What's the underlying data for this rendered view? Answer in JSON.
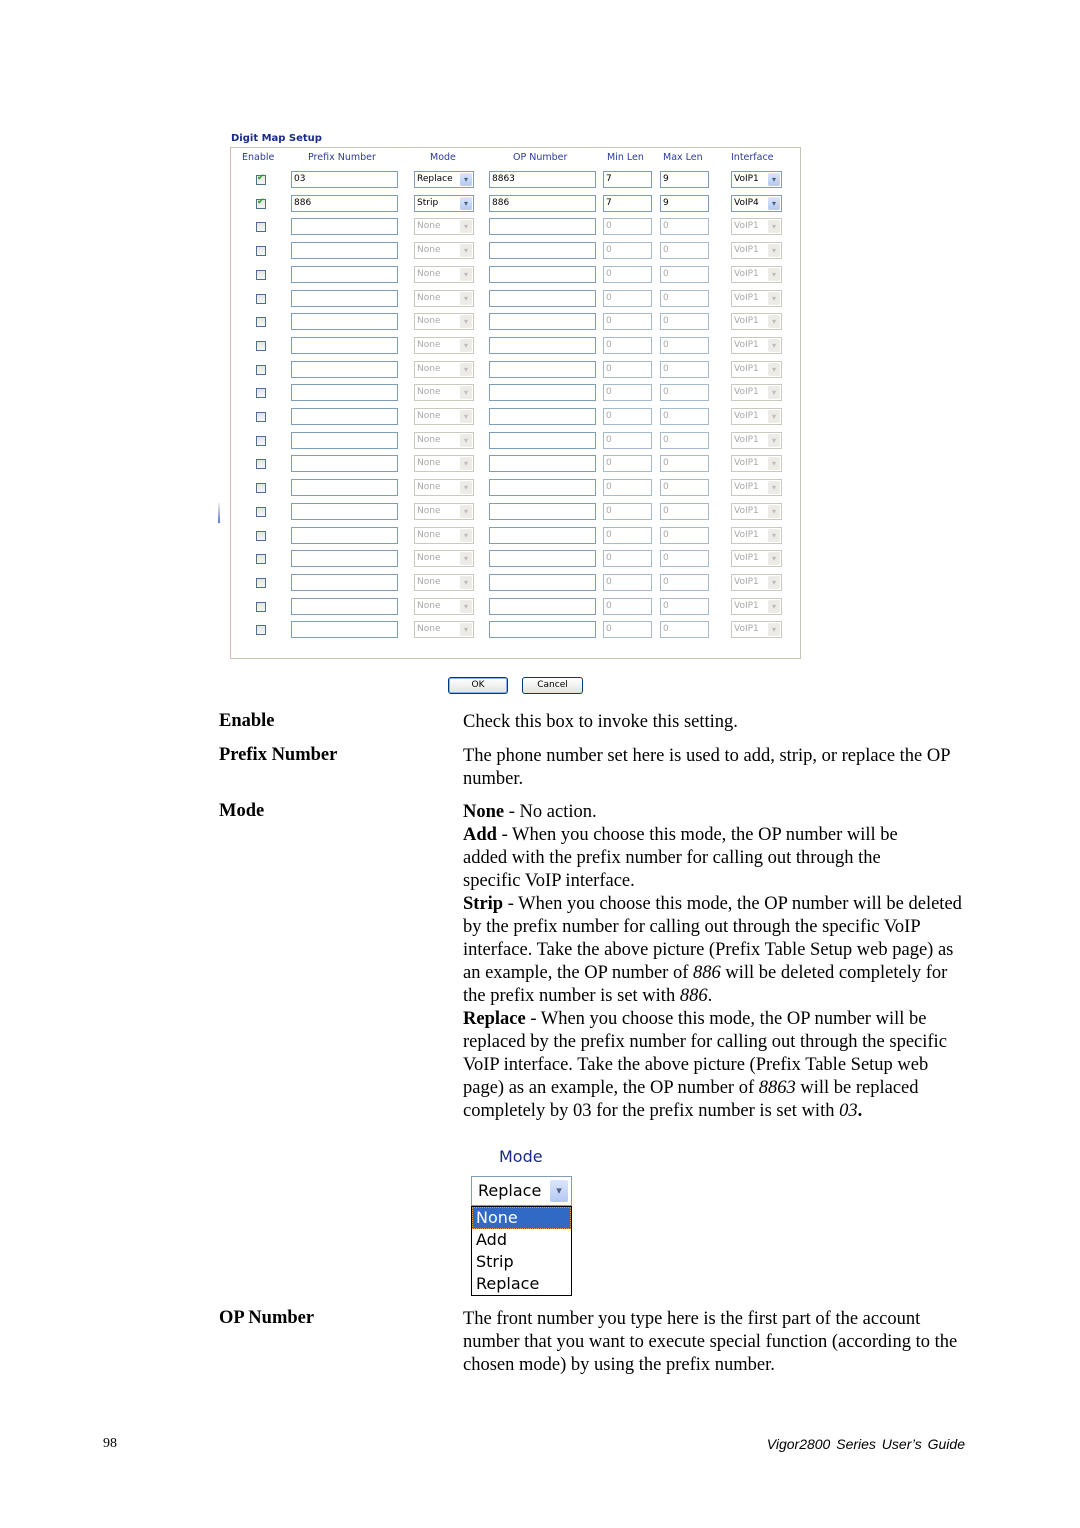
{
  "panel": {
    "title": "Digit Map Setup",
    "headers": {
      "enable": "Enable",
      "prefix": "Prefix Number",
      "mode": "Mode",
      "op": "OP Number",
      "min": "Min Len",
      "max": "Max Len",
      "iface": "Interface"
    },
    "rows": [
      {
        "enabled": true,
        "prefix": "03",
        "mode": "Replace",
        "op": "8863",
        "min": "7",
        "max": "9",
        "iface": "VoIP1"
      },
      {
        "enabled": true,
        "prefix": "886",
        "mode": "Strip",
        "op": "886",
        "min": "7",
        "max": "9",
        "iface": "VoIP4"
      },
      {
        "enabled": false,
        "prefix": "",
        "mode": "None",
        "op": "",
        "min": "0",
        "max": "0",
        "iface": "VoIP1"
      },
      {
        "enabled": false,
        "prefix": "",
        "mode": "None",
        "op": "",
        "min": "0",
        "max": "0",
        "iface": "VoIP1"
      },
      {
        "enabled": false,
        "prefix": "",
        "mode": "None",
        "op": "",
        "min": "0",
        "max": "0",
        "iface": "VoIP1"
      },
      {
        "enabled": false,
        "prefix": "",
        "mode": "None",
        "op": "",
        "min": "0",
        "max": "0",
        "iface": "VoIP1"
      },
      {
        "enabled": false,
        "prefix": "",
        "mode": "None",
        "op": "",
        "min": "0",
        "max": "0",
        "iface": "VoIP1"
      },
      {
        "enabled": false,
        "prefix": "",
        "mode": "None",
        "op": "",
        "min": "0",
        "max": "0",
        "iface": "VoIP1"
      },
      {
        "enabled": false,
        "prefix": "",
        "mode": "None",
        "op": "",
        "min": "0",
        "max": "0",
        "iface": "VoIP1"
      },
      {
        "enabled": false,
        "prefix": "",
        "mode": "None",
        "op": "",
        "min": "0",
        "max": "0",
        "iface": "VoIP1"
      },
      {
        "enabled": false,
        "prefix": "",
        "mode": "None",
        "op": "",
        "min": "0",
        "max": "0",
        "iface": "VoIP1"
      },
      {
        "enabled": false,
        "prefix": "",
        "mode": "None",
        "op": "",
        "min": "0",
        "max": "0",
        "iface": "VoIP1"
      },
      {
        "enabled": false,
        "prefix": "",
        "mode": "None",
        "op": "",
        "min": "0",
        "max": "0",
        "iface": "VoIP1"
      },
      {
        "enabled": false,
        "prefix": "",
        "mode": "None",
        "op": "",
        "min": "0",
        "max": "0",
        "iface": "VoIP1"
      },
      {
        "enabled": false,
        "prefix": "",
        "mode": "None",
        "op": "",
        "min": "0",
        "max": "0",
        "iface": "VoIP1"
      },
      {
        "enabled": false,
        "prefix": "",
        "mode": "None",
        "op": "",
        "min": "0",
        "max": "0",
        "iface": "VoIP1"
      },
      {
        "enabled": false,
        "prefix": "",
        "mode": "None",
        "op": "",
        "min": "0",
        "max": "0",
        "iface": "VoIP1"
      },
      {
        "enabled": false,
        "prefix": "",
        "mode": "None",
        "op": "",
        "min": "0",
        "max": "0",
        "iface": "VoIP1"
      },
      {
        "enabled": false,
        "prefix": "",
        "mode": "None",
        "op": "",
        "min": "0",
        "max": "0",
        "iface": "VoIP1"
      },
      {
        "enabled": false,
        "prefix": "",
        "mode": "None",
        "op": "",
        "min": "0",
        "max": "0",
        "iface": "VoIP1"
      }
    ],
    "ok_label": "OK",
    "cancel_label": "Cancel",
    "arrow_icon": "▾"
  },
  "doc": {
    "enable": {
      "term": "Enable",
      "desc": "Check this box to invoke this setting."
    },
    "prefix": {
      "term": "Prefix Number",
      "desc": "The phone number set here is used to add, strip, or replace the OP number."
    },
    "mode": {
      "term": "Mode",
      "none_b": "None",
      "none_t": " - No action.",
      "add_b": "Add",
      "add_t": " - When you choose this mode, the OP number will be added with the prefix number for calling out through the specific VoIP interface.",
      "strip_b": "Strip",
      "strip_t1": " - When you choose this mode, the OP number will be deleted by the prefix number for calling out through the specific VoIP interface. Take the above picture (Prefix Table Setup web page) as an example, the OP number of ",
      "strip_i1": "886",
      "strip_t2": " will be deleted completely for the prefix number is set with ",
      "strip_i2": "886",
      "strip_t3": ".",
      "replace_b": "Replace",
      "replace_t1": " - When you choose this mode, the OP number will be replaced by the prefix number for calling out through the specific VoIP interface. Take the above picture (Prefix Table Setup web page) as an example, the OP number of ",
      "replace_i1": "8863",
      "replace_t2": " will be replaced completely by 03 for the prefix number is set with ",
      "replace_i2": "03",
      "replace_t3": "."
    },
    "mode_dropdown": {
      "label": "Mode",
      "selected": "Replace",
      "options": [
        "None",
        "Add",
        "Strip",
        "Replace"
      ],
      "highlighted": "None"
    },
    "op": {
      "term": "OP Number",
      "desc": "The front number you type here is the first part of the account number that you want to execute special function (according to the chosen mode) by using the prefix number."
    }
  },
  "footer": {
    "page_number": "98",
    "guide_title": "Vigor2800  Series  User’s  Guide"
  }
}
